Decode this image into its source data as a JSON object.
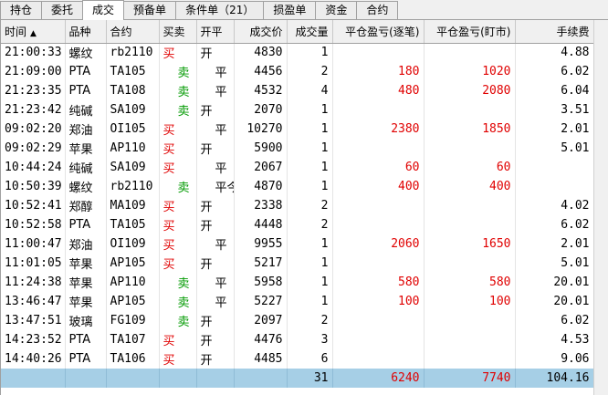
{
  "tabs": [
    "持仓",
    "委托",
    "成交",
    "预备单",
    "条件单（21）",
    "损盈单",
    "资金",
    "合约"
  ],
  "active_tab": 2,
  "columns": [
    "时间",
    "品种",
    "合约",
    "买卖",
    "开平",
    "成交价",
    "成交量",
    "平仓盈亏(逐笔)",
    "平仓盈亏(盯市)",
    "手续费"
  ],
  "rows": [
    {
      "time": "21:00:33",
      "product": "螺纹",
      "contract": "rb2110",
      "side": "买",
      "offset": "开",
      "price": "4830",
      "qty": "1",
      "pnl_trade": "",
      "pnl_mtm": "",
      "fee": "4.88"
    },
    {
      "time": "21:09:00",
      "product": "PTA",
      "contract": "TA105",
      "side": "卖",
      "offset": "平",
      "price": "4456",
      "qty": "2",
      "pnl_trade": "180",
      "pnl_mtm": "1020",
      "fee": "6.02"
    },
    {
      "time": "21:23:35",
      "product": "PTA",
      "contract": "TA108",
      "side": "卖",
      "offset": "平",
      "price": "4532",
      "qty": "4",
      "pnl_trade": "480",
      "pnl_mtm": "2080",
      "fee": "6.04"
    },
    {
      "time": "21:23:42",
      "product": "纯碱",
      "contract": "SA109",
      "side": "卖",
      "offset": "开",
      "price": "2070",
      "qty": "1",
      "pnl_trade": "",
      "pnl_mtm": "",
      "fee": "3.51"
    },
    {
      "time": "09:02:20",
      "product": "郑油",
      "contract": "OI105",
      "side": "买",
      "offset": "平",
      "price": "10270",
      "qty": "1",
      "pnl_trade": "2380",
      "pnl_mtm": "1850",
      "fee": "2.01"
    },
    {
      "time": "09:02:29",
      "product": "苹果",
      "contract": "AP110",
      "side": "买",
      "offset": "开",
      "price": "5900",
      "qty": "1",
      "pnl_trade": "",
      "pnl_mtm": "",
      "fee": "5.01"
    },
    {
      "time": "10:44:24",
      "product": "纯碱",
      "contract": "SA109",
      "side": "买",
      "offset": "平",
      "price": "2067",
      "qty": "1",
      "pnl_trade": "60",
      "pnl_mtm": "60",
      "fee": ""
    },
    {
      "time": "10:50:39",
      "product": "螺纹",
      "contract": "rb2110",
      "side": "卖",
      "offset": "平今",
      "price": "4870",
      "qty": "1",
      "pnl_trade": "400",
      "pnl_mtm": "400",
      "fee": ""
    },
    {
      "time": "10:52:41",
      "product": "郑醇",
      "contract": "MA109",
      "side": "买",
      "offset": "开",
      "price": "2338",
      "qty": "2",
      "pnl_trade": "",
      "pnl_mtm": "",
      "fee": "4.02"
    },
    {
      "time": "10:52:58",
      "product": "PTA",
      "contract": "TA105",
      "side": "买",
      "offset": "开",
      "price": "4448",
      "qty": "2",
      "pnl_trade": "",
      "pnl_mtm": "",
      "fee": "6.02"
    },
    {
      "time": "11:00:47",
      "product": "郑油",
      "contract": "OI109",
      "side": "买",
      "offset": "平",
      "price": "9955",
      "qty": "1",
      "pnl_trade": "2060",
      "pnl_mtm": "1650",
      "fee": "2.01"
    },
    {
      "time": "11:01:05",
      "product": "苹果",
      "contract": "AP105",
      "side": "买",
      "offset": "开",
      "price": "5217",
      "qty": "1",
      "pnl_trade": "",
      "pnl_mtm": "",
      "fee": "5.01"
    },
    {
      "time": "11:24:38",
      "product": "苹果",
      "contract": "AP110",
      "side": "卖",
      "offset": "平",
      "price": "5958",
      "qty": "1",
      "pnl_trade": "580",
      "pnl_mtm": "580",
      "fee": "20.01"
    },
    {
      "time": "13:46:47",
      "product": "苹果",
      "contract": "AP105",
      "side": "卖",
      "offset": "平",
      "price": "5227",
      "qty": "1",
      "pnl_trade": "100",
      "pnl_mtm": "100",
      "fee": "20.01"
    },
    {
      "time": "13:47:51",
      "product": "玻璃",
      "contract": "FG109",
      "side": "卖",
      "offset": "开",
      "price": "2097",
      "qty": "2",
      "pnl_trade": "",
      "pnl_mtm": "",
      "fee": "6.02"
    },
    {
      "time": "14:23:52",
      "product": "PTA",
      "contract": "TA107",
      "side": "买",
      "offset": "开",
      "price": "4476",
      "qty": "3",
      "pnl_trade": "",
      "pnl_mtm": "",
      "fee": "4.53"
    },
    {
      "time": "14:40:26",
      "product": "PTA",
      "contract": "TA106",
      "side": "买",
      "offset": "开",
      "price": "4485",
      "qty": "6",
      "pnl_trade": "",
      "pnl_mtm": "",
      "fee": "9.06"
    }
  ],
  "total": {
    "qty": "31",
    "pnl_trade": "6240",
    "pnl_mtm": "7740",
    "fee": "104.16"
  },
  "colors": {
    "buy": "#e00000",
    "sell": "#009a00",
    "total_row": "#a6cfe6"
  }
}
